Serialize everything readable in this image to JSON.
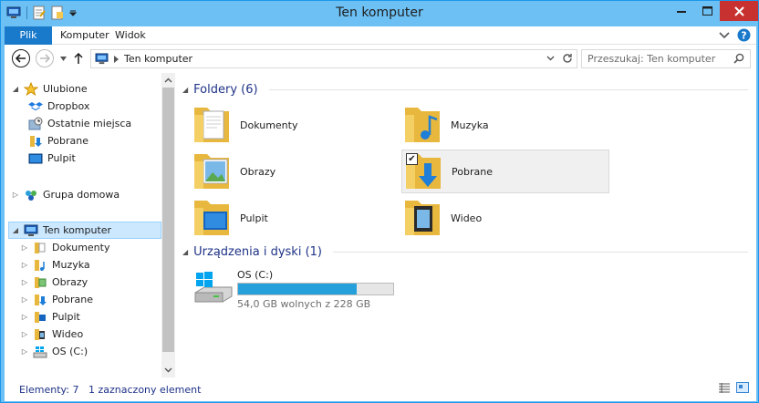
{
  "window": {
    "title": "Ten komputer"
  },
  "ribbon": {
    "tabs": [
      {
        "label": "Plik"
      },
      {
        "label": "Komputer"
      },
      {
        "label": "Widok"
      }
    ]
  },
  "address": {
    "path": "Ten komputer",
    "search_placeholder": "Przeszukaj: Ten komputer"
  },
  "nav": {
    "favorites": {
      "label": "Ulubione",
      "items": [
        {
          "label": "Dropbox",
          "icon": "dropbox-icon"
        },
        {
          "label": "Ostatnie miejsca",
          "icon": "recent-places-icon"
        },
        {
          "label": "Pobrane",
          "icon": "downloads-folder-icon"
        },
        {
          "label": "Pulpit",
          "icon": "desktop-icon"
        }
      ]
    },
    "homegroup": {
      "label": "Grupa domowa"
    },
    "computer": {
      "label": "Ten komputer",
      "items": [
        {
          "label": "Dokumenty"
        },
        {
          "label": "Muzyka"
        },
        {
          "label": "Obrazy"
        },
        {
          "label": "Pobrane"
        },
        {
          "label": "Pulpit"
        },
        {
          "label": "Wideo"
        },
        {
          "label": "OS (C:)"
        }
      ]
    }
  },
  "content": {
    "folders_header": "Foldery (6)",
    "folders": [
      {
        "label": "Dokumenty"
      },
      {
        "label": "Muzyka"
      },
      {
        "label": "Obrazy"
      },
      {
        "label": "Pobrane",
        "selected": true
      },
      {
        "label": "Pulpit"
      },
      {
        "label": "Wideo"
      }
    ],
    "devices_header": "Urządzenia i dyski (1)",
    "drive": {
      "name": "OS (C:)",
      "free_text": "54,0 GB wolnych z 228 GB",
      "used_fraction": 0.763
    }
  },
  "status": {
    "count": "Elementy: 7",
    "selected": "1 zaznaczony element"
  },
  "colors": {
    "titlebar": "#6cc0f4",
    "accent": "#1979ca",
    "close": "#c7312f",
    "drive_fill": "#26a0da"
  }
}
